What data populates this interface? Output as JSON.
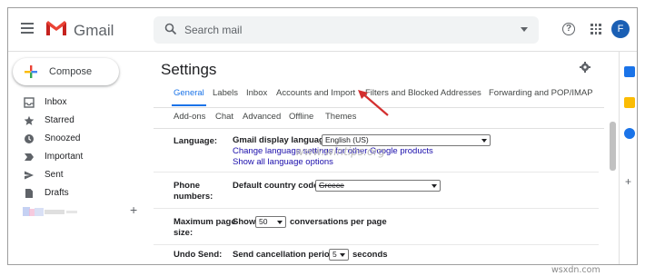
{
  "app": {
    "name": "Gmail",
    "avatar_letter": "F"
  },
  "search": {
    "placeholder": "Search mail"
  },
  "compose": {
    "label": "Compose"
  },
  "sidebar": {
    "items": [
      {
        "label": "Inbox",
        "icon": "inbox-icon"
      },
      {
        "label": "Starred",
        "icon": "star-icon"
      },
      {
        "label": "Snoozed",
        "icon": "clock-icon"
      },
      {
        "label": "Important",
        "icon": "label-important-icon"
      },
      {
        "label": "Sent",
        "icon": "send-icon"
      },
      {
        "label": "Drafts",
        "icon": "draft-icon"
      }
    ],
    "add_label": "+"
  },
  "settings": {
    "title": "Settings",
    "tabs_row1": [
      "General",
      "Labels",
      "Inbox",
      "Accounts and Import",
      "Filters and Blocked Addresses",
      "Forwarding and POP/IMAP"
    ],
    "tabs_row2": [
      "Add-ons",
      "Chat",
      "Advanced",
      "Offline",
      "Themes"
    ],
    "active_tab": "General",
    "language": {
      "label": "Language:",
      "field_label": "Gmail display language:",
      "value": "English (US)",
      "link1": "Change language settings for other Google products",
      "link2": "Show all language options"
    },
    "phone": {
      "label_line1": "Phone",
      "label_line2": "numbers:",
      "field_label": "Default country code:",
      "value": "Greece"
    },
    "page_size": {
      "label_line1": "Maximum page",
      "label_line2": "size:",
      "prefix": "Show",
      "value": "50",
      "suffix": "conversations per page"
    },
    "undo_send": {
      "label": "Undo Send:",
      "prefix": "Send cancellation period:",
      "value": "5",
      "suffix": "seconds"
    }
  },
  "watermark": "www.wintips.org",
  "footer": "wsxdn.com",
  "colors": {
    "accent": "#1a73e8",
    "link": "#1a0dab",
    "arrow": "#d32f2f",
    "avatar": "#1a5fb4"
  }
}
